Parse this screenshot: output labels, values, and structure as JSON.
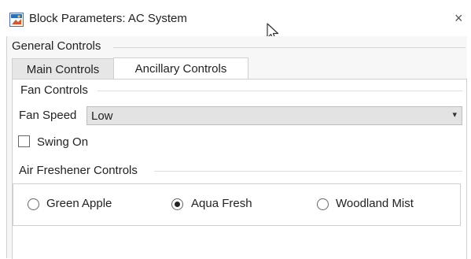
{
  "window": {
    "title": "Block Parameters: AC System",
    "close_glyph": "×"
  },
  "section": {
    "title": "General Controls"
  },
  "tabs": [
    {
      "label": "Main Controls",
      "selected": false
    },
    {
      "label": "Ancillary Controls",
      "selected": true
    }
  ],
  "fan_controls": {
    "group_title": "Fan Controls",
    "speed_label": "Fan Speed",
    "speed_value": "Low",
    "swing_label": "Swing On",
    "swing_checked": false
  },
  "air_freshener": {
    "group_title": "Air Freshener Controls",
    "options": [
      {
        "label": "Green Apple",
        "selected": false
      },
      {
        "label": "Aqua Fresh",
        "selected": true
      },
      {
        "label": "Woodland Mist",
        "selected": false
      }
    ]
  }
}
